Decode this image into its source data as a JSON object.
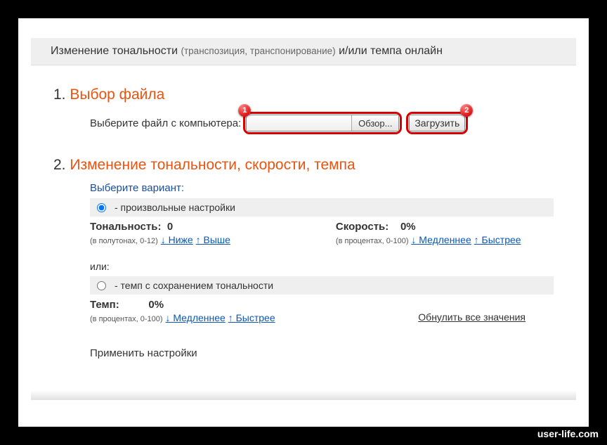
{
  "header": {
    "prefix": "Изменение тональности",
    "paren": "(транспозиция, транспонирование)",
    "suffix": "и/или темпа онлайн"
  },
  "step1": {
    "num": "1.",
    "title": "Выбор файла",
    "label": "Выберите файл с компьютера:",
    "browse": "Обзор...",
    "upload": "Загрузить",
    "marker1": "1",
    "marker2": "2"
  },
  "step2": {
    "num": "2.",
    "title": "Изменение тональности, скорости, темпа",
    "variant_label": "Выберите вариант:",
    "option_custom": "- произвольные настройки",
    "option_tempo": "- темп с сохранением тональности",
    "tonality": {
      "label": "Тональность:",
      "value": "0",
      "hint": "(в полутонах, 0-12)",
      "lower": "↓ Ниже",
      "higher": "↑ Выше"
    },
    "speed": {
      "label": "Скорость:",
      "value": "0%",
      "hint": "(в процентах, 0-100)",
      "slower": "↓ Медленнее",
      "faster": "↑ Быстрее"
    },
    "or": "или:",
    "tempo": {
      "label": "Темп:",
      "value": "0%",
      "hint": "(в процентах, 0-100)",
      "slower": "↓ Медленнее",
      "faster": "↑ Быстрее"
    },
    "reset": "Обнулить все значения",
    "apply": "Применить настройки"
  },
  "watermark": "user-life.com"
}
